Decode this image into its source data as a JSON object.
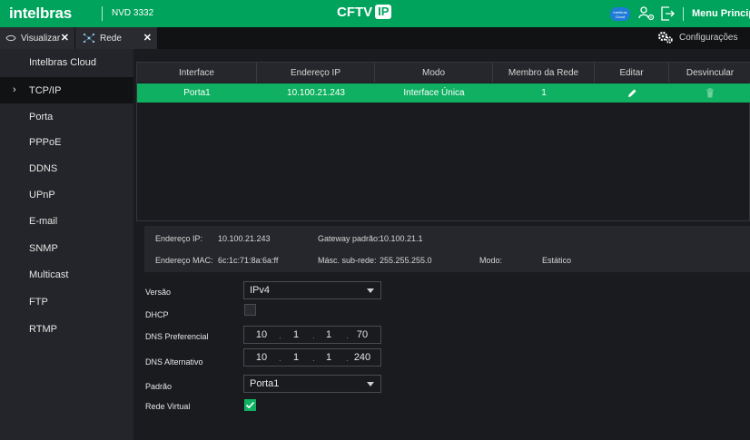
{
  "header": {
    "brand": "intelbras",
    "model": "NVD 3332",
    "title_text": "CFTV",
    "title_badge": "IP",
    "cloud_badge": "Intelbras Cloud",
    "menu_label": "Menu Principal",
    "accent_color": "#00a35c"
  },
  "tabs": [
    {
      "label": "Visualizar",
      "icon": "eye-icon"
    },
    {
      "label": "Rede",
      "icon": "network-icon"
    }
  ],
  "config": {
    "label": "Configurações",
    "icon": "gears-icon"
  },
  "sidebar": {
    "items": [
      {
        "label": "Intelbras Cloud"
      },
      {
        "label": "TCP/IP",
        "active": true
      },
      {
        "label": "Porta"
      },
      {
        "label": "PPPoE"
      },
      {
        "label": "DDNS"
      },
      {
        "label": "UPnP"
      },
      {
        "label": "E-mail"
      },
      {
        "label": "SNMP"
      },
      {
        "label": "Multicast"
      },
      {
        "label": "FTP"
      },
      {
        "label": "RTMP"
      }
    ]
  },
  "table": {
    "columns": [
      "Interface",
      "Endereço IP",
      "Modo",
      "Membro da Rede",
      "Editar",
      "Desvincular"
    ],
    "rows": [
      {
        "interface": "Porta1",
        "ip": "10.100.21.243",
        "mode": "Interface Única",
        "member": "1",
        "edit_icon": "pencil-icon",
        "unlink_icon": "trash-icon"
      }
    ],
    "selected_color": "#0fb061"
  },
  "info": {
    "ip_label": "Endereço IP:",
    "ip_value": "10.100.21.243",
    "gateway_label": "Gateway padrão:",
    "gateway_value": "10.100.21.1",
    "mac_label": "Endereço MAC:",
    "mac_value": "6c:1c:71:8a:6a:ff",
    "mask_label": "Másc. sub-rede:",
    "mask_value": "255.255.255.0",
    "mode_label": "Modo:",
    "mode_value": "Estático"
  },
  "form": {
    "version_label": "Versão",
    "version_value": "IPv4",
    "dhcp_label": "DHCP",
    "dhcp_checked": false,
    "dns_pref_label": "DNS Preferencial",
    "dns_pref": [
      "10",
      "1",
      "1",
      "70"
    ],
    "dns_alt_label": "DNS Alternativo",
    "dns_alt": [
      "10",
      "1",
      "1",
      "240"
    ],
    "default_label": "Padrão",
    "default_value": "Porta1",
    "virtual_label": "Rede Virtual",
    "virtual_checked": true
  }
}
